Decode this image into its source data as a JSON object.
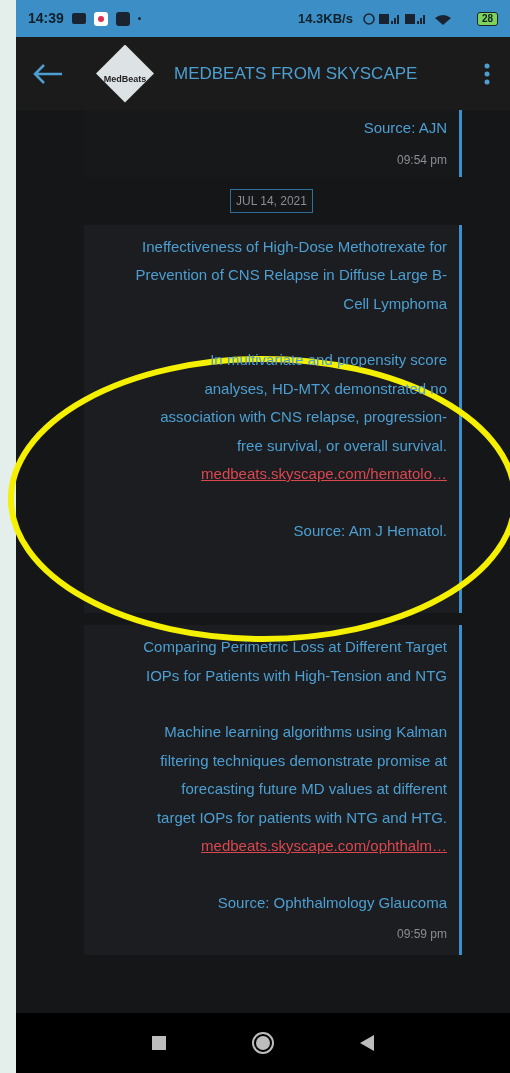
{
  "status_bar": {
    "time": "14:39",
    "speed": "14.3KB/s",
    "battery": "28"
  },
  "header": {
    "logo_text": "MedBeats",
    "title": "MEDBEATS FROM SKYSCAPE"
  },
  "feed": [
    {
      "kind": "message",
      "partial": true,
      "source": "Source: AJN",
      "time": "09:54 pm"
    },
    {
      "kind": "date",
      "label": "JUL 14, 2021"
    },
    {
      "kind": "message",
      "partial": false,
      "title": "Ineffectiveness of High-Dose Methotrexate for Prevention of CNS Relapse in Diffuse Large B-Cell Lymphoma",
      "body": "In multivariate and propensity score analyses, HD-MTX demonstrated no association with CNS relapse, progression-free survival, or overall survival.",
      "link": "medbeats.skyscape.com/hematolo…",
      "source": "Source: Am J Hematol."
    },
    {
      "kind": "message",
      "partial": false,
      "title": "Comparing Perimetric Loss at Different Target IOPs for Patients with High-Tension and NTG",
      "body": "Machine learning algorithms using Kalman filtering techniques demonstrate promise at forecasting future MD values at different target IOPs for patients with NTG and HTG.",
      "link": "medbeats.skyscape.com/ophthalm…",
      "source": "Source: Ophthalmology Glaucoma",
      "time": "09:59 pm"
    }
  ],
  "annotation": {
    "shown": true
  }
}
